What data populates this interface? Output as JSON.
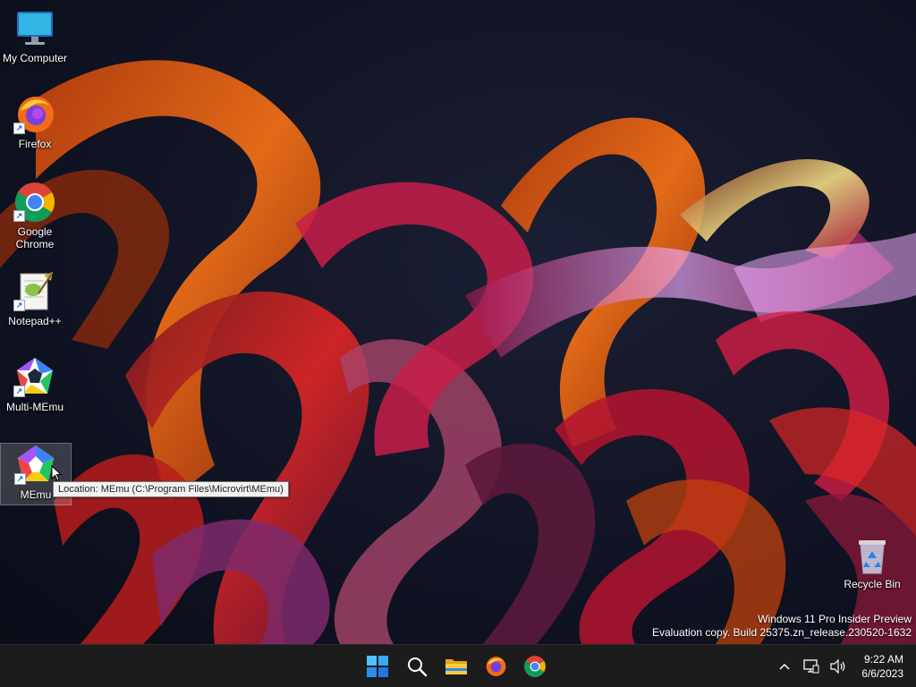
{
  "desktop": {
    "icons": [
      {
        "label": "My Computer",
        "icon": "my-computer-icon"
      },
      {
        "label": "Firefox",
        "icon": "firefox-icon"
      },
      {
        "label": "Google Chrome",
        "icon": "chrome-icon"
      },
      {
        "label": "Notepad++",
        "icon": "notepadplusplus-icon"
      },
      {
        "label": "Multi-MEmu",
        "icon": "multi-memu-icon"
      },
      {
        "label": "MEmu",
        "icon": "memu-icon"
      },
      {
        "label": "Recycle Bin",
        "icon": "recycle-bin-icon"
      }
    ],
    "tooltip": "Location: MEmu (C:\\Program Files\\Microvirt\\MEmu)",
    "watermark": {
      "line1": "Windows 11 Pro Insider Preview",
      "line2": "Evaluation copy. Build 25375.zn_release.230520-1632"
    }
  },
  "taskbar": {
    "pinned": [
      "start-icon",
      "search-icon",
      "file-explorer-icon",
      "firefox-icon",
      "chrome-icon"
    ],
    "tray": {
      "time": "9:22 AM",
      "date": "6/6/2023"
    }
  },
  "colors": {
    "taskbar_bg": "#1c1c1c",
    "accent": "#2b8cf0"
  }
}
